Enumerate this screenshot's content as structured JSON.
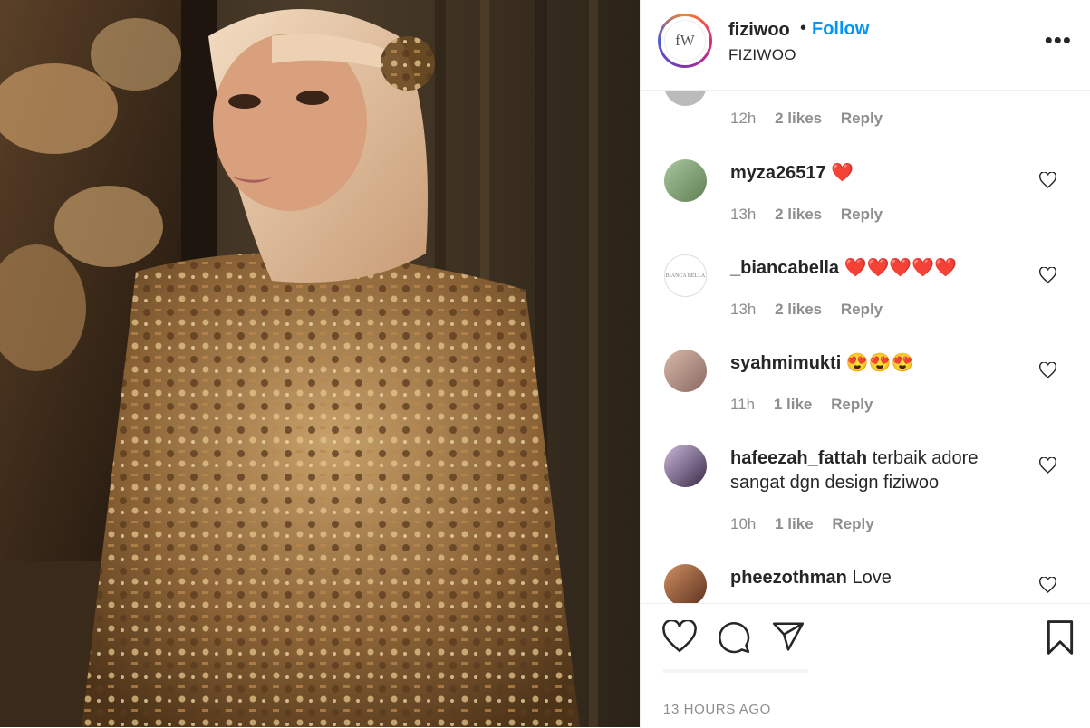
{
  "header": {
    "username": "fiziwoo",
    "separator": "•",
    "follow_label": "Follow",
    "subtitle": "FIZIWOO",
    "avatar_text": "fW",
    "more_label": "•••"
  },
  "comments": [
    {
      "user": "",
      "text": "",
      "time": "12h",
      "likes": "2 likes",
      "reply": "Reply"
    },
    {
      "user": "myza26517",
      "text": " ❤️",
      "time": "13h",
      "likes": "2 likes",
      "reply": "Reply"
    },
    {
      "user": "_biancabella",
      "text": " ❤️❤️❤️❤️❤️",
      "time": "13h",
      "likes": "2 likes",
      "reply": "Reply",
      "avatar_text": "BIANCA BELLA"
    },
    {
      "user": "syahmimukti",
      "text": " 😍😍😍",
      "time": "11h",
      "likes": "1 like",
      "reply": "Reply"
    },
    {
      "user": "hafeezah_fattah",
      "text": " terbaik adore sangat dgn design fiziwoo",
      "time": "10h",
      "likes": "1 like",
      "reply": "Reply"
    },
    {
      "user": "pheezothman",
      "text": " Love",
      "time": "",
      "likes": "",
      "reply": ""
    }
  ],
  "footer": {
    "time_ago": "13 HOURS AGO"
  },
  "colors": {
    "follow": "#0095f6",
    "muted": "#8e8e8e",
    "text": "#262626"
  },
  "icons": [
    "heart-icon",
    "comment-icon",
    "share-icon",
    "bookmark-icon",
    "more-icon"
  ]
}
